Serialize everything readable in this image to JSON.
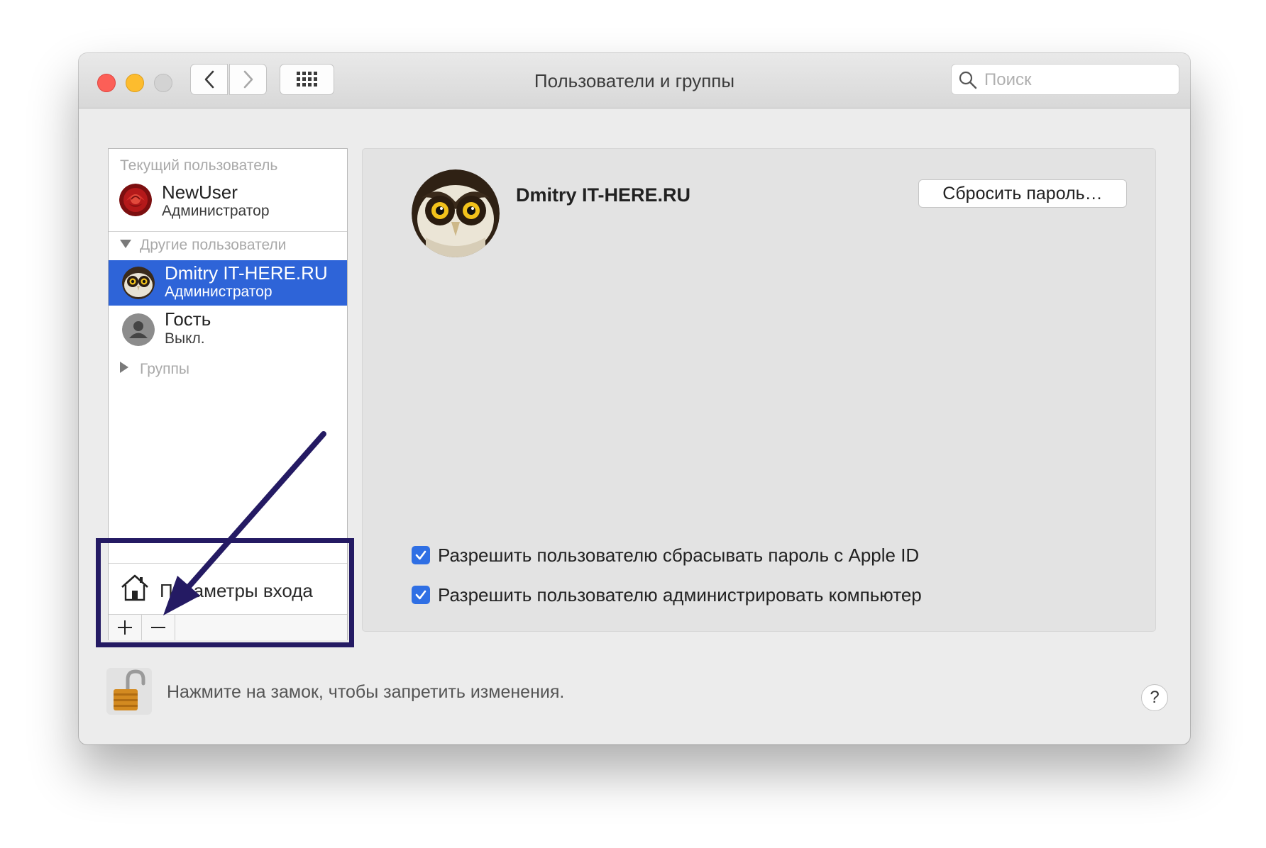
{
  "window": {
    "title": "Пользователи и группы",
    "search_placeholder": "Поиск"
  },
  "sidebar": {
    "current_header": "Текущий пользователь",
    "current_user": {
      "name": "NewUser",
      "role": "Администратор"
    },
    "others_header": "Другие пользователи",
    "other_users": [
      {
        "name": "Dmitry IT-HERE.RU",
        "role": "Администратор",
        "selected": true
      },
      {
        "name": "Гость",
        "role": "Выкл.",
        "selected": false
      }
    ],
    "groups_header": "Группы",
    "login_options": "Параметры входа",
    "add_label": "+",
    "remove_label": "—"
  },
  "detail": {
    "user_name": "Dmitry IT-HERE.RU",
    "reset_button": "Сбросить пароль…",
    "checkboxes": [
      {
        "label": "Разрешить пользователю сбрасывать пароль с Apple ID",
        "checked": true
      },
      {
        "label": "Разрешить пользователю администрировать компьютер",
        "checked": true
      }
    ]
  },
  "footer": {
    "lock_text": "Нажмите на замок, чтобы запретить изменения.",
    "help_label": "?"
  },
  "colors": {
    "selection": "#2e64d8",
    "checkbox": "#2f6fe4",
    "annotation": "#241a63"
  }
}
